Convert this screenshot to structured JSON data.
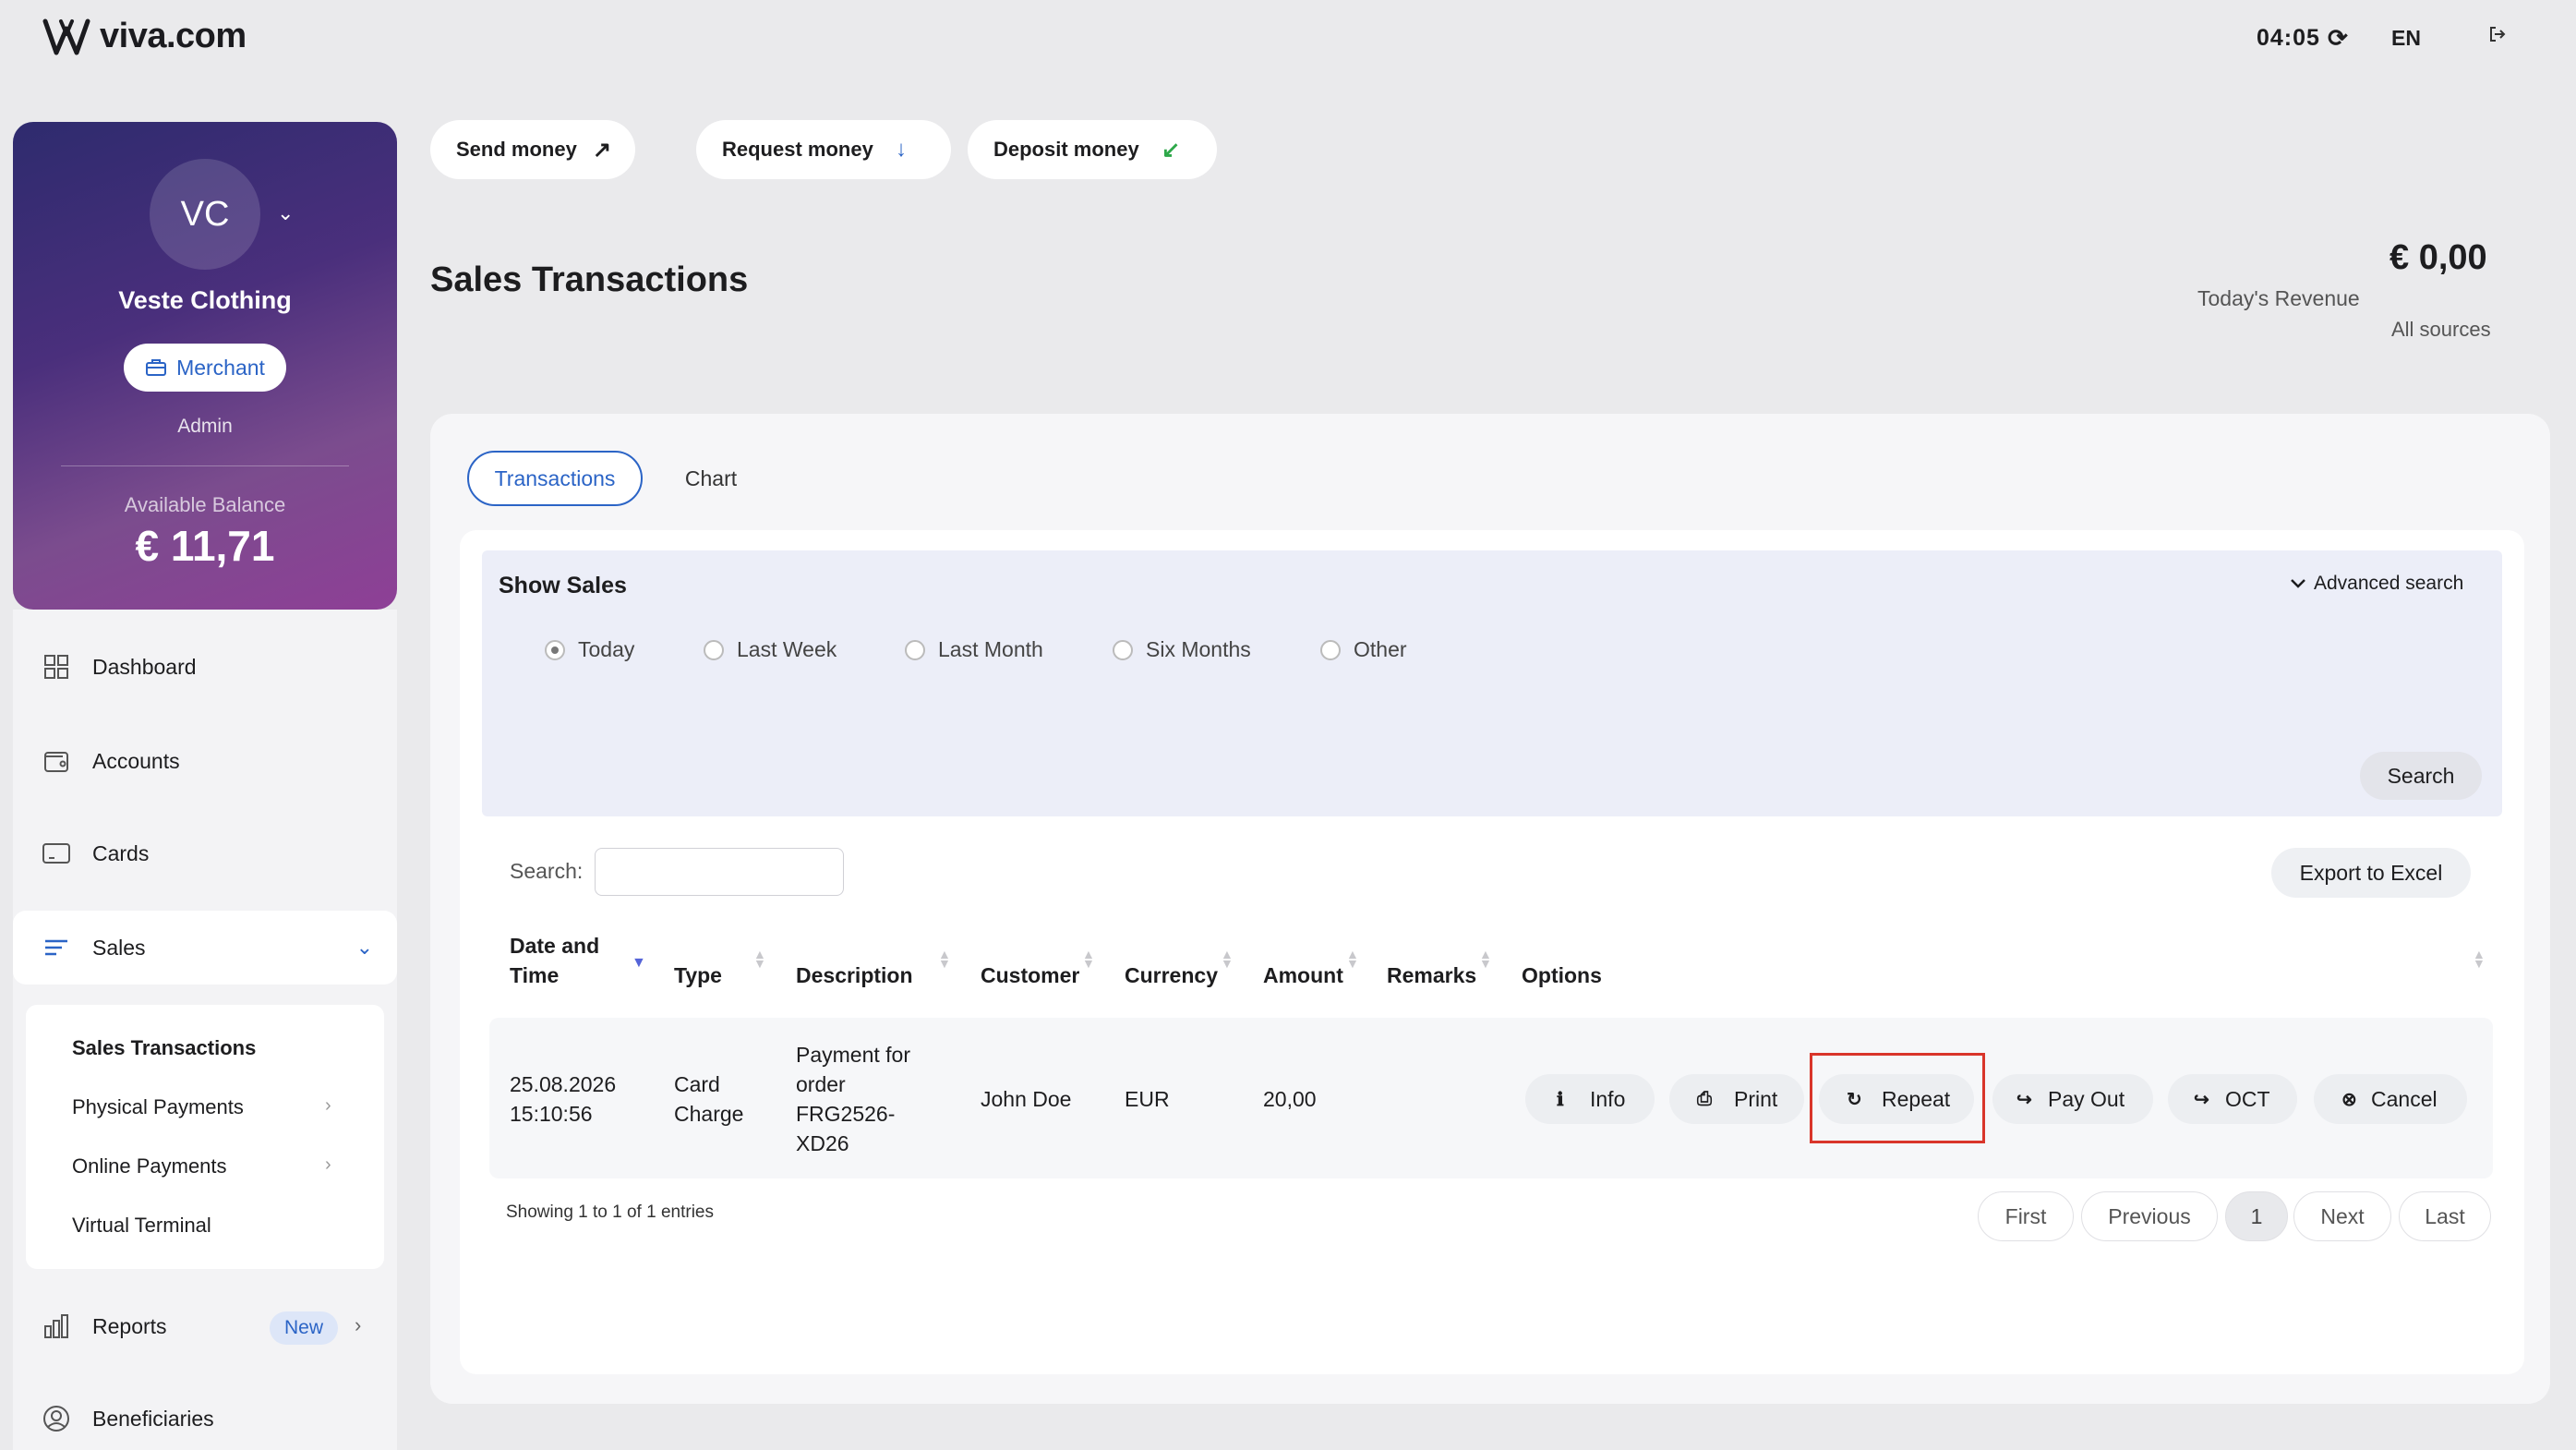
{
  "header": {
    "brand": "viva.com",
    "time": "04:05",
    "language": "EN"
  },
  "profile": {
    "initials": "VC",
    "company": "Veste Clothing",
    "role": "Merchant",
    "subrole": "Admin",
    "balance_label": "Available Balance",
    "balance": "€ 11,71"
  },
  "nav": {
    "dashboard": "Dashboard",
    "accounts": "Accounts",
    "cards": "Cards",
    "sales": "Sales",
    "reports": "Reports",
    "reports_badge": "New",
    "beneficiaries": "Beneficiaries"
  },
  "submenu": {
    "sales_transactions": "Sales Transactions",
    "physical_payments": "Physical Payments",
    "online_payments": "Online Payments",
    "virtual_terminal": "Virtual Terminal"
  },
  "actions": {
    "send": "Send money",
    "request": "Request money",
    "deposit": "Deposit money"
  },
  "page": {
    "title": "Sales Transactions",
    "revenue": "€ 0,00",
    "revenue_label": "Today's Revenue",
    "revenue_sub": "All sources"
  },
  "tabs": {
    "transactions": "Transactions",
    "chart": "Chart"
  },
  "filter": {
    "title": "Show Sales",
    "advanced": "Advanced search",
    "options": [
      "Today",
      "Last Week",
      "Last Month",
      "Six Months",
      "Other"
    ],
    "selected": "Today",
    "search_button": "Search"
  },
  "table": {
    "search_label": "Search:",
    "search_value": "",
    "export": "Export to Excel",
    "headers": {
      "date_line1": "Date and",
      "date_line2": "Time",
      "type": "Type",
      "description": "Description",
      "customer": "Customer",
      "currency": "Currency",
      "amount": "Amount",
      "remarks": "Remarks",
      "options": "Options"
    },
    "rows": [
      {
        "date": "25.08.2026",
        "time": "15:10:56",
        "type_line1": "Card",
        "type_line2": "Charge",
        "desc_line1": "Payment for",
        "desc_line2": "order",
        "desc_line3": "FRG2526-",
        "desc_line4": "XD26",
        "customer": "John Doe",
        "currency": "EUR",
        "amount": "20,00",
        "remarks": ""
      }
    ],
    "options": {
      "info": "Info",
      "print": "Print",
      "repeat": "Repeat",
      "payout": "Pay Out",
      "oct": "OCT",
      "cancel": "Cancel"
    },
    "showing": "Showing 1 to 1 of 1 entries",
    "pagination": {
      "first": "First",
      "previous": "Previous",
      "current": "1",
      "next": "Next",
      "last": "Last"
    }
  },
  "colors": {
    "accent": "#2b64c6",
    "highlight": "#d9352a",
    "card_gradient_start": "#2e2b6e",
    "card_gradient_end": "#8e3f96"
  }
}
